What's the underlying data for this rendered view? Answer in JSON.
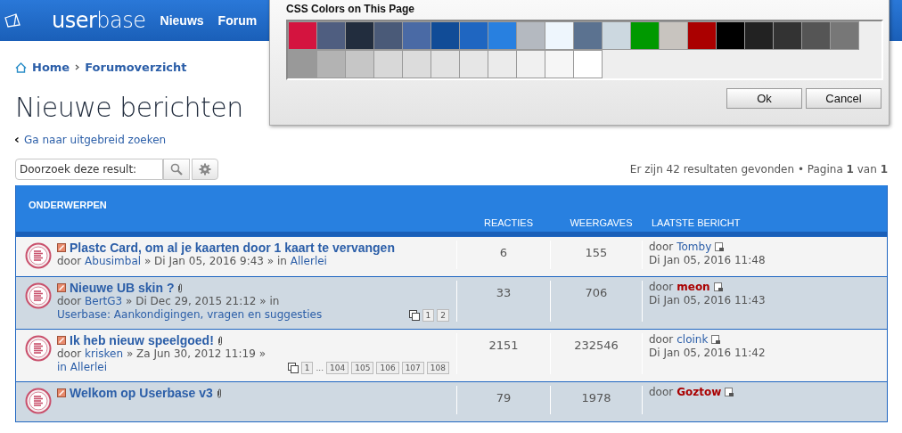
{
  "header": {
    "logo": "**user**base",
    "nav": [
      "Nieuws",
      "Forum"
    ]
  },
  "breadcrumb": [
    "Home",
    "Forumoverzicht"
  ],
  "title": "Nieuwe berichten",
  "advanced_search_link": "Ga naar uitgebreid zoeken",
  "search": {
    "value": "Doorzoek deze result:"
  },
  "results_summary": "Er zijn 42 resultaten gevonden • Pagina **1** van **1**",
  "table": {
    "columns": [
      "ONDERWERPEN",
      "REACTIES",
      "WEERGAVES",
      "LAATSTE BERICHT"
    ],
    "rows": [
      {
        "title": "Plastc Card, om al je kaarten door 1 kaart te vervangen",
        "attachment": false,
        "by": "door",
        "author": "Abusimbal",
        "date": "» Di Jan 05, 2016 9:43 » in",
        "forum": "Allerlei",
        "pages": [],
        "replies": "6",
        "views": "155",
        "last_post": {
          "by": "door",
          "author": "Tomby",
          "color": "#2b5ea8",
          "date": "Di Jan 05, 2016 11:48"
        }
      },
      {
        "title": "Nieuwe UB skin ?",
        "attachment": true,
        "by": "door",
        "author": "BertG3",
        "date": "» Di Dec 29, 2015 21:12 » in",
        "forum": "Userbase: Aankondigingen, vragen en suggesties",
        "pages": [
          {
            "kind": "page",
            "label": "1"
          },
          {
            "kind": "page",
            "label": "2"
          }
        ],
        "replies": "33",
        "views": "706",
        "last_post": {
          "by": "door",
          "author": "meon",
          "color": "#aa0000",
          "date": "Di Jan 05, 2016 11:43"
        }
      },
      {
        "title": "Ik heb nieuw speelgoed!",
        "attachment": true,
        "by": "door",
        "author": "krisken",
        "date": "» Za Jun 30, 2012 11:19 »",
        "forum": "in Allerlei",
        "pages": [
          {
            "kind": "page",
            "label": "1"
          },
          {
            "kind": "gap",
            "label": "..."
          },
          {
            "kind": "page",
            "label": "104"
          },
          {
            "kind": "page",
            "label": "105"
          },
          {
            "kind": "page",
            "label": "106"
          },
          {
            "kind": "page",
            "label": "107"
          },
          {
            "kind": "page",
            "label": "108"
          }
        ],
        "replies": "2151",
        "views": "232546",
        "last_post": {
          "by": "door",
          "author": "cloink",
          "color": "#2b5ea8",
          "date": "Di Jan 05, 2016 11:42"
        }
      },
      {
        "title": "Welkom op Userbase v3",
        "attachment": true,
        "pages": [],
        "replies": "79",
        "views": "1978",
        "last_post": {
          "by": "door",
          "author": "Goztow",
          "color": "#aa0000"
        }
      }
    ]
  },
  "dialog": {
    "title": "CSS Colors on This Page",
    "swatches": [
      {
        "color": "#d4143f"
      },
      {
        "color": "#4f5e80"
      },
      {
        "color": "#222d3e"
      },
      {
        "color": "#4a5a78"
      },
      {
        "color": "#4a6aa5"
      },
      {
        "color": "#114c97"
      },
      {
        "color": "#1f66c1"
      },
      {
        "color": "#2880e0"
      },
      {
        "color": "#b4b9c0"
      },
      {
        "color": "#eef6fd"
      },
      {
        "color": "#5b7290"
      },
      {
        "color": "#ccd8e0"
      },
      {
        "color": "#009900"
      },
      {
        "color": "#c8c4bf"
      },
      {
        "color": "#aa0000"
      },
      {
        "color": "#000000"
      },
      {
        "color": "#222222"
      },
      {
        "color": "#333333"
      },
      {
        "color": "#555555"
      },
      {
        "color": "#777777"
      },
      {
        "color": "#999999"
      },
      {
        "color": "#b3b3b3"
      },
      {
        "color": "#c6c6c6"
      },
      {
        "color": "#d8d8d8"
      },
      {
        "color": "#dcdcdc"
      },
      {
        "color": "#e2e2e2"
      },
      {
        "color": "#e6e6e6"
      },
      {
        "color": "#ebebeb"
      },
      {
        "color": "#f0f0f0"
      },
      {
        "color": "#f6f6f6"
      },
      {
        "color": "#ffffff"
      }
    ],
    "buttons": [
      "Ok",
      "Cancel"
    ]
  }
}
